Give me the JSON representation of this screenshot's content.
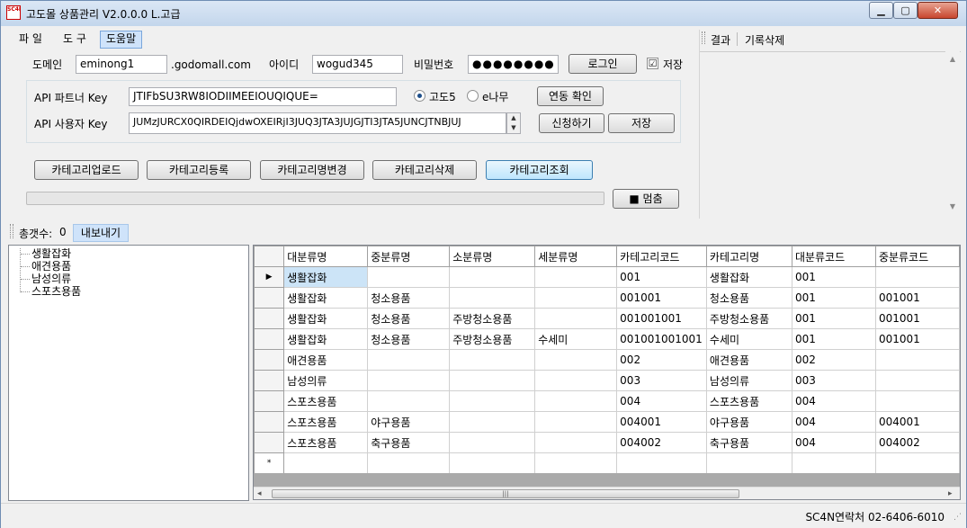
{
  "window": {
    "title": "고도몰 상품관리 V2.0.0.0 L.고급",
    "app_icon_label": "SC4N",
    "minimize_glyph": "▁",
    "maximize_glyph": "▢",
    "close_glyph": "✕"
  },
  "menu": {
    "items": [
      {
        "label": "파 일"
      },
      {
        "label": "도 구"
      },
      {
        "label": "도움말"
      }
    ]
  },
  "login": {
    "domain_label": "도메인",
    "domain_value": "eminong1",
    "domain_suffix": ".godomall.com",
    "id_label": "아이디",
    "id_value": "wogud345",
    "password_label": "비밀번호",
    "password_value": "●●●●●●●●",
    "login_button": "로그인",
    "save_check": "☑",
    "save_label": "저장"
  },
  "api": {
    "partner_key_label": "API 파트너 Key",
    "partner_key_value": "JTIFbSU3RW8IODIIMEEIOUQIQUE=",
    "user_key_label": "API 사용자 Key",
    "user_key_value": "JUMzJURCX0QIRDEIQjdwOXEIRjI3JUQ3JTA3JUJGJTI3JTA5JUNCJTNBJUJ",
    "radio_godo5": "고도5",
    "radio_enamu": "e나무",
    "link_check_button": "연동 확인",
    "apply_button": "신청하기",
    "save_button": "저장"
  },
  "category_buttons": {
    "upload": "카테고리업로드",
    "register": "카테고리등록",
    "rename": "카테고리명변경",
    "delete": "카테고리삭제",
    "lookup": "카테고리조회"
  },
  "stop_button": "■ 멈춤",
  "progress": 0,
  "result_panel": {
    "tab_result": "결과",
    "tab_clear": "기록삭제"
  },
  "summary": {
    "total_label": "총갯수:",
    "total_value": "0",
    "export_button": "내보내기"
  },
  "tree": {
    "items": [
      "생활잡화",
      "애견용품",
      "남성의류",
      "스포츠용품"
    ]
  },
  "grid": {
    "columns": [
      "대분류명",
      "중분류명",
      "소분류명",
      "세분류명",
      "카테고리코드",
      "카테고리명",
      "대분류코드",
      "중분류코드"
    ],
    "rows": [
      [
        "생활잡화",
        "",
        "",
        "",
        "001",
        "생활잡화",
        "001",
        ""
      ],
      [
        "생활잡화",
        "청소용품",
        "",
        "",
        "001001",
        "청소용품",
        "001",
        "001001"
      ],
      [
        "생활잡화",
        "청소용품",
        "주방청소용품",
        "",
        "001001001",
        "주방청소용품",
        "001",
        "001001"
      ],
      [
        "생활잡화",
        "청소용품",
        "주방청소용품",
        "수세미",
        "001001001001",
        "수세미",
        "001",
        "001001"
      ],
      [
        "애견용품",
        "",
        "",
        "",
        "002",
        "애견용품",
        "002",
        ""
      ],
      [
        "남성의류",
        "",
        "",
        "",
        "003",
        "남성의류",
        "003",
        ""
      ],
      [
        "스포츠용품",
        "",
        "",
        "",
        "004",
        "스포츠용품",
        "004",
        ""
      ],
      [
        "스포츠용품",
        "야구용품",
        "",
        "",
        "004001",
        "야구용품",
        "004",
        "004001"
      ],
      [
        "스포츠용품",
        "축구용품",
        "",
        "",
        "004002",
        "축구용품",
        "004",
        "004002"
      ]
    ],
    "current_row_marker": "▶",
    "new_row_marker": "*",
    "scroll_left": "◂",
    "scroll_right": "▸",
    "scroll_grip": "|||"
  },
  "status": {
    "contact": "SC4N연락처 02-6406-6010"
  }
}
